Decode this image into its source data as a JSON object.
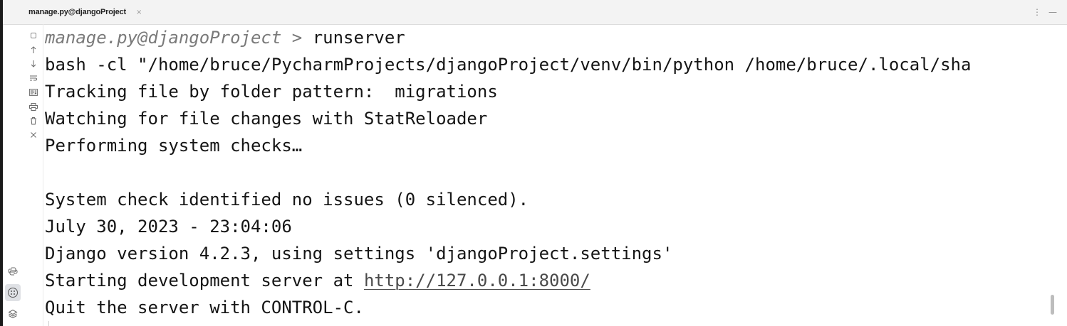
{
  "tab": {
    "title": "manage.py@djangoProject",
    "close_glyph": "×",
    "actions": [
      "⋮",
      "—"
    ]
  },
  "toolbar": {
    "icons": [
      "stop-icon",
      "up-arrow-icon",
      "down-arrow-icon",
      "soft-wrap-icon",
      "scroll-to-end-icon",
      "print-icon",
      "trash-icon",
      "close-icon"
    ]
  },
  "side_tools": {
    "icons": [
      "python-packages-icon",
      "services-icon",
      "layers-icon"
    ],
    "active_index": 1
  },
  "console": {
    "prompt": {
      "path": "manage.py@djangoProject",
      "separator": " > ",
      "command": "runserver"
    },
    "lines": [
      "bash -cl \"/home/bruce/PycharmProjects/djangoProject/venv/bin/python /home/bruce/.local/sha",
      "Tracking file by folder pattern:  migrations",
      "Watching for file changes with StatReloader",
      "Performing system checks…",
      "",
      "System check identified no issues (0 silenced).",
      "July 30, 2023 - 23:04:06",
      "Django version 4.2.3, using settings 'djangoProject.settings'"
    ],
    "server_line": {
      "prefix": "Starting development server at ",
      "url": "http://127.0.0.1:8000/"
    },
    "quit_line": "Quit the server with CONTROL-C."
  }
}
